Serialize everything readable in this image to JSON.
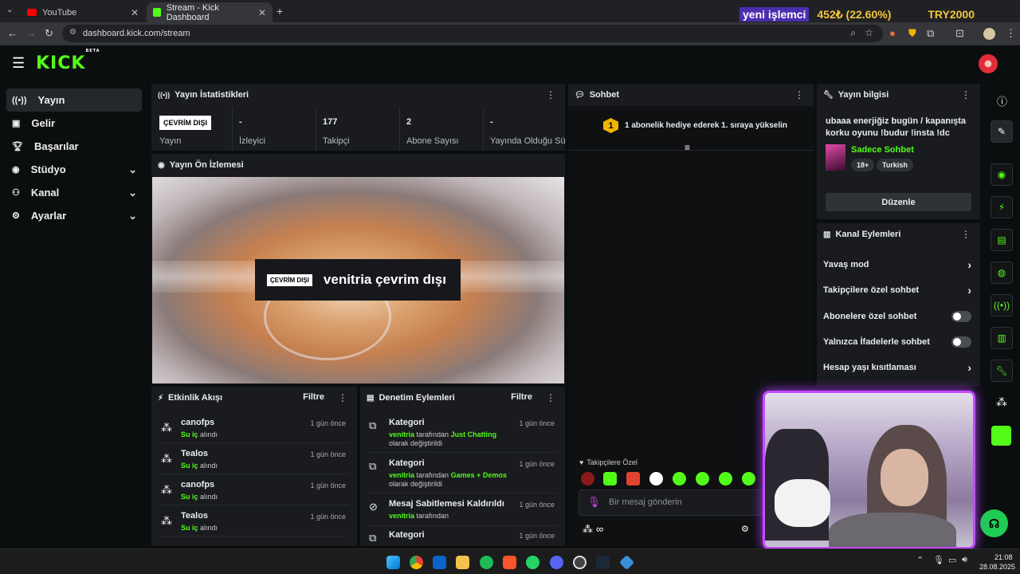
{
  "browser": {
    "tabs": [
      {
        "title": "YouTube",
        "active": false
      },
      {
        "title": "Stream - Kick Dashboard",
        "active": true
      }
    ],
    "new_tab": "+",
    "url": "dashboard.kick.com/stream",
    "ticker": {
      "label": "yeni işlemci",
      "value": "452₺ (22.60%)",
      "currency": "TRY2000"
    }
  },
  "header": {
    "logo": "KICK",
    "logo_tag": "BETA"
  },
  "sidebar": {
    "items": [
      {
        "label": "Yayın",
        "icon": "broadcast-icon",
        "expandable": false,
        "selected": true
      },
      {
        "label": "Gelir",
        "icon": "wallet-icon",
        "expandable": false
      },
      {
        "label": "Başarılar",
        "icon": "trophy-icon",
        "expandable": false
      },
      {
        "label": "Stüdyo",
        "icon": "camera-icon",
        "expandable": true
      },
      {
        "label": "Kanal",
        "icon": "users-icon",
        "expandable": true
      },
      {
        "label": "Ayarlar",
        "icon": "gear-icon",
        "expandable": true
      }
    ]
  },
  "stats": {
    "title": "Yayın İstatistikleri",
    "status_badge": "ÇEVRİM DIŞI",
    "cells": [
      {
        "label": "Yayın",
        "value": ""
      },
      {
        "label": "İzleyici",
        "value": "-"
      },
      {
        "label": "Takipçi",
        "value": "177"
      },
      {
        "label": "Abone Sayısı",
        "value": "2"
      },
      {
        "label": "Yayında Olduğu Süre",
        "value": "-"
      }
    ]
  },
  "preview": {
    "title": "Yayın Ön İzlemesi",
    "badge": "ÇEVRİM DIŞI",
    "message": "venitria çevrim dışı"
  },
  "activity": {
    "title": "Etkinlik Akışı",
    "filter": "Filtre",
    "items": [
      {
        "name": "canofps",
        "highlight": "Su iç",
        "action": "alındı",
        "time": "1 gün önce"
      },
      {
        "name": "Tealos",
        "highlight": "Su iç",
        "action": "alındı",
        "time": "1 gün önce"
      },
      {
        "name": "canofps",
        "highlight": "Su iç",
        "action": "alındı",
        "time": "1 gün önce"
      },
      {
        "name": "Tealos",
        "highlight": "Su iç",
        "action": "alındı",
        "time": "1 gün önce"
      }
    ]
  },
  "moderation": {
    "title": "Denetim Eylemleri",
    "filter": "Filtre",
    "items": [
      {
        "title": "Kategori",
        "user": "venitria",
        "mid": "tarafından",
        "category": "Just Chatting",
        "tail": "olarak değiştirildi",
        "time": "1 gün önce",
        "icon": "category-icon"
      },
      {
        "title": "Kategori",
        "user": "venitria",
        "mid": "tarafından",
        "category": "Games + Demos",
        "tail": "olarak değiştirildi",
        "time": "1 gün önce",
        "icon": "category-icon"
      },
      {
        "title": "Mesaj Sabitlemesi Kaldırıldı",
        "user": "venitria",
        "mid": "tarafından",
        "category": "",
        "tail": "",
        "time": "1 gün önce",
        "icon": "unpin-icon"
      },
      {
        "title": "Kategori",
        "user": "",
        "mid": "",
        "category": "",
        "tail": "",
        "time": "1 gün önce",
        "icon": "category-icon"
      }
    ]
  },
  "chat": {
    "title": "Sohbet",
    "pinned_rank": "1",
    "pinned_text": "1 abonelik hediye ederek 1. sıraya yükselin",
    "followers_only": "Takipçilere Özel",
    "input_placeholder": "Bir mesaj gönderin",
    "footer_symbol": "∞"
  },
  "stream_info": {
    "title": "Yayın bilgisi",
    "stream_title": "ubaaa enerjiğiz bugün / kapanışta korku oyunu !budur !insta !dc",
    "category": "Sadece Sohbet",
    "tags": [
      "18+",
      "Turkish"
    ],
    "edit_button": "Düzenle"
  },
  "channel_actions": {
    "title": "Kanal Eylemleri",
    "items": [
      {
        "label": "Yavaş mod",
        "type": "chevron"
      },
      {
        "label": "Takipçilere özel sohbet",
        "type": "chevron"
      },
      {
        "label": "Abonelere özel sohbet",
        "type": "toggle",
        "on": false
      },
      {
        "label": "Yalnızca İfadelerle sohbet",
        "type": "toggle",
        "on": false
      },
      {
        "label": "Hesap yaşı kısıtlaması",
        "type": "chevron"
      }
    ]
  },
  "taskbar": {
    "time": "21:08",
    "date": "28.08.2025"
  },
  "colors": {
    "accent": "#53fc18",
    "panel": "#191b1f",
    "background": "#0b0e0f"
  }
}
